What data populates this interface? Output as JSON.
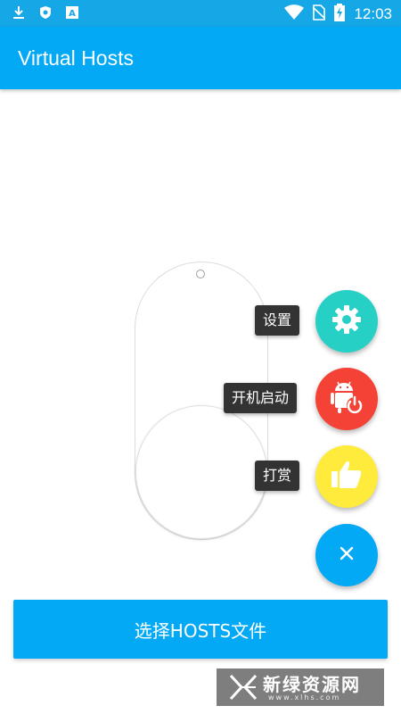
{
  "status_bar": {
    "time": "12:03",
    "icons": [
      "download-icon",
      "shield-icon",
      "a-badge-icon",
      "wifi-icon",
      "no-sim-icon",
      "battery-charging-icon"
    ]
  },
  "app_bar": {
    "title": "Virtual Hosts"
  },
  "toggle": {
    "state": "off"
  },
  "fab_menu": {
    "items": [
      {
        "label": "设置",
        "icon": "gear-icon",
        "color": "#26d0c4"
      },
      {
        "label": "开机启动",
        "icon": "android-power-icon",
        "color": "#f44336"
      },
      {
        "label": "打赏",
        "icon": "thumbs-up-icon",
        "color": "#ffeb3b"
      }
    ],
    "close": {
      "icon": "close-icon",
      "color": "#03a9f4"
    }
  },
  "bottom_button": {
    "label": "选择HOSTS文件"
  },
  "watermark": {
    "text": "新绿资源网",
    "sub": "www.xlhs.com"
  },
  "colors": {
    "primary": "#03a9f4",
    "primary_dark": "#15a7e6"
  }
}
